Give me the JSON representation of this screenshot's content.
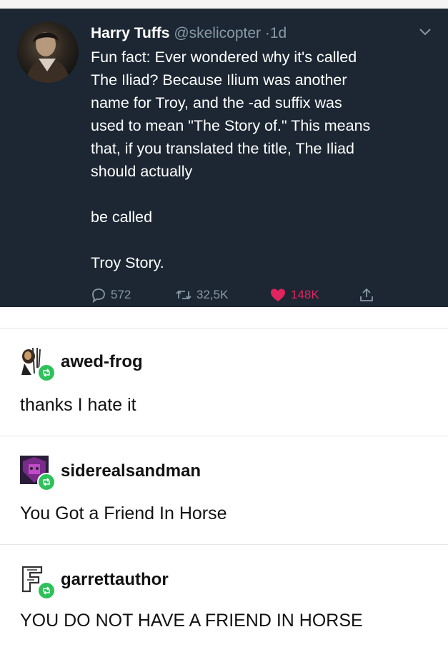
{
  "tweet": {
    "author_name": "Harry Tuffs",
    "author_handle": "@skelicopter",
    "separator": "·",
    "time": "1d",
    "body_lines": [
      "Fun fact: Ever wondered why it's called",
      "The Iliad? Because Ilium was another",
      "name for Troy, and the -ad suffix was",
      "used to mean \"The Story of.\" This means",
      "that, if you translated the title, The Iliad",
      "should actually"
    ],
    "body_mid": "be called",
    "body_end": "Troy Story.",
    "replies": "572",
    "retweets": "32,5K",
    "likes": "148K",
    "colors": {
      "background": "#1c2733",
      "like": "#e0245e",
      "muted": "#8899a6"
    }
  },
  "notes": [
    {
      "username": "awed-frog",
      "text": "thanks I hate it",
      "avatar": "awed-frog-avatar"
    },
    {
      "username": "siderealsandman",
      "text": "You Got a Friend In Horse",
      "avatar": "siderealsandman-avatar"
    },
    {
      "username": "garrettauthor",
      "text": "YOU DO NOT HAVE A FRIEND IN HORSE",
      "avatar": "garrettauthor-avatar"
    }
  ],
  "reblog_color": "#2ec15a"
}
